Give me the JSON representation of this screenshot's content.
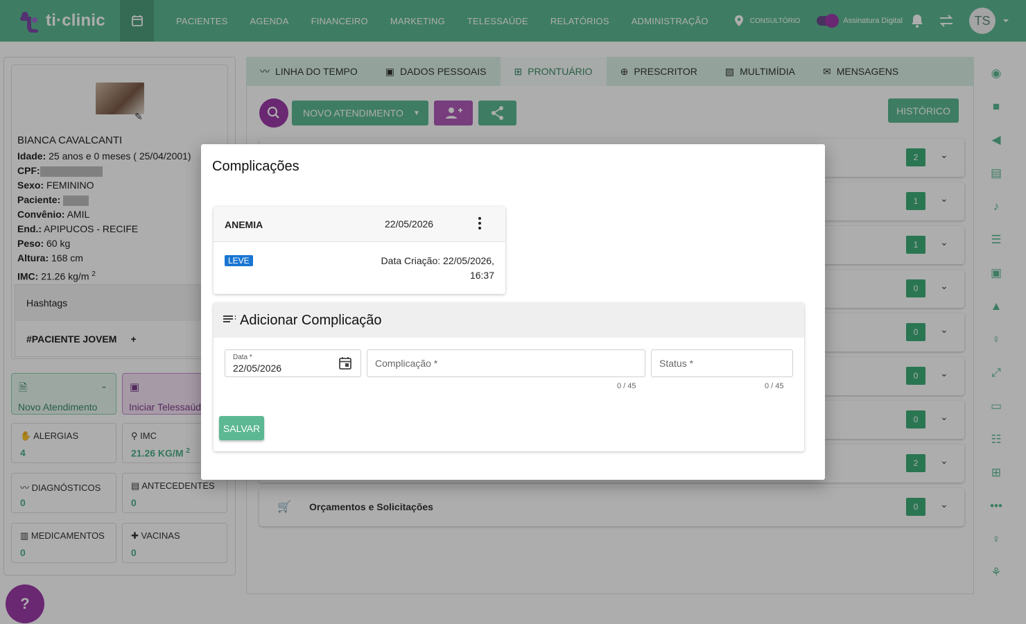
{
  "brand": {
    "name": "ti·clinic"
  },
  "nav": {
    "items": [
      "PACIENTES",
      "AGENDA",
      "FINANCEIRO",
      "MARKETING",
      "TELESSAÚDE",
      "RELATÓRIOS",
      "ADMINISTRAÇÃO"
    ]
  },
  "topbar": {
    "location": "CONSULTÓRIO",
    "signature_label": "Assinatura Digital",
    "user_initials": "TS"
  },
  "patient": {
    "name": "BIANCA CAVALCANTI",
    "age_label": "Idade:",
    "age_value": "25 anos e 0 meses ( 25/04/2001)",
    "cpf_label": "CPF:",
    "sex_label": "Sexo:",
    "sex_value": "FEMININO",
    "patient_label": "Paciente:",
    "insurance_label": "Convênio:",
    "insurance_value": "AMIL",
    "address_label": "End.:",
    "address_value": "APIPUCOS -  RECIFE",
    "weight_label": "Peso:",
    "weight_value": "60 kg",
    "height_label": "Altura:",
    "height_value": "168 cm",
    "bmi_label": "IMC:",
    "bmi_value": "21.26 kg/m",
    "bmi_sup": "2"
  },
  "hashtags": {
    "title": "Hashtags",
    "tag": "#PACIENTE JOVEM",
    "add": "+"
  },
  "quick": {
    "novo": "Novo Atendimento",
    "tele": "Iniciar Telessaúde"
  },
  "stats": [
    {
      "label": "ALERGIAS",
      "value": "4"
    },
    {
      "label": "IMC",
      "value": "21.26 KG/M",
      "sup": "2"
    },
    {
      "label": "DIAGNÓSTICOS",
      "value": "0"
    },
    {
      "label": "ANTECEDENTES",
      "value": "0"
    },
    {
      "label": "MEDICAMENTOS",
      "value": "0"
    },
    {
      "label": "VACINAS",
      "value": "0"
    }
  ],
  "tabs": [
    "LINHA DO TEMPO",
    "DADOS PESSOAIS",
    "PRONTUÁRIO",
    "PRESCRITOR",
    "MULTIMÍDIA",
    "MENSAGENS"
  ],
  "actions": {
    "novo_atendimento": "NOVO ATENDIMENTO",
    "historico": "HISTÓRICO"
  },
  "sections": {
    "badges": [
      "2",
      "1",
      "1",
      "0",
      "0",
      "0",
      "0",
      "2",
      "0"
    ],
    "last_title": "Orçamentos e Solicitações"
  },
  "dialog": {
    "title": "Complicações",
    "item": {
      "name": "ANEMIA",
      "date": "22/05/2026",
      "severity": "LEVE",
      "created_line1": "Data Criação: 22/05/2026,",
      "created_line2": "16:37"
    },
    "form": {
      "title": "Adicionar Complicação",
      "date_label": "Data *",
      "date_value": "22/05/2026",
      "complication_placeholder": "Complicação *",
      "status_placeholder": "Status *",
      "counter_complication": "0 / 45",
      "counter_status": "0 / 45",
      "save": "SALVAR"
    }
  },
  "colors": {
    "primary": "#5cb892",
    "accent": "#9c3aa8",
    "badge": "#3fae7a",
    "severity": "#1976d2"
  }
}
